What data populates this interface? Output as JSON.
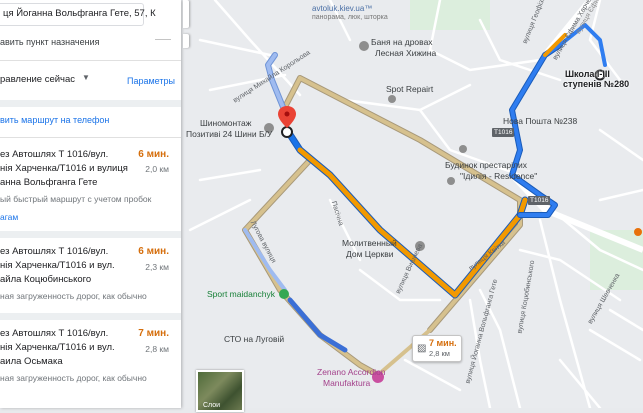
{
  "search": {
    "destination_value": "ця Йоганна Вольфганга Гете, 57, К",
    "add_destination": "авить пункт назначения"
  },
  "options": {
    "depart_now": "равление сейчас",
    "parameters": "Параметры"
  },
  "send_to_phone": "вить маршрут на телефон",
  "routes": [
    {
      "line1": "ез Автошлях Т 1016/вул.",
      "line2": "нія Харченка/Т1016 и вулиця",
      "line3": "анна Вольфганга Гете",
      "time": "6 мин.",
      "distance": "2,0 км",
      "note": "ый быстрый маршрут с учетом пробок",
      "details": "агам"
    },
    {
      "line1": "ез Автошлях Т 1016/вул.",
      "line2": "нія Харченка/Т1016 и вул.",
      "line3": "айла Коцюбинського",
      "time": "6 мин.",
      "distance": "2,3 км",
      "note": "ная загруженность дорог, как обычно"
    },
    {
      "line1": "ез Автошлях Т 1016/вул.",
      "line2": "нія Харченка/Т1016 и вул.",
      "line3": "аила Осьмака",
      "time": "7 мин.",
      "distance": "2,8 км",
      "note": "ная загруженность дорог, как обычно"
    }
  ],
  "map": {
    "watermark": "avtoluk.kiev.ua™",
    "watermark_sub": "панорама, люк, шторка",
    "poi_sauna": [
      "Баня на дровах",
      "Лесная Хижина"
    ],
    "poi_spot_repair": "Spot Repairt",
    "poi_tire": [
      "Шиномонтаж",
      "Позитиві 24 Шини Б/У"
    ],
    "poi_post": "Нова Пошта №238",
    "poi_elderly": [
      "Будинок престарілих",
      "\"Ідилія - Residence\""
    ],
    "poi_church": [
      "Молитвенный",
      "Дом Церкви"
    ],
    "poi_sport": "Sport maidanchyk",
    "poi_sto": "СТО на Луговій",
    "poi_zenano": [
      "Zenano Accordion",
      "Manufaktura"
    ],
    "poi_school": [
      "Школа І-ІІІ",
      "ступенів №280"
    ],
    "street_koroliova": "вулиця Михайла Корольова",
    "street_kharchenka": "вулиця Єфима Харченка",
    "street_kharchenka2": "вулиця Єфима Харченка",
    "street_kvitky": "вулиця Квітки",
    "street_lugova": "Лугова вулиця",
    "street_pasichna": "Пасічна",
    "street_vishneva": "вулиця Вишнева",
    "street_kotsyubynskogo": "вулиця Коцюбинського",
    "street_gete": "вулиця Йоганна Вольфганга Гете",
    "street_shevchenka": "вулиця Шевченка",
    "street_kukhmistra": "вулиця Геофізиків",
    "road_t1016_a": "T1016",
    "road_t1016_b": "T1016",
    "trip_bubble_time": "7 мин.",
    "trip_bubble_dist": "2,8 км",
    "thumb_label": "Слои",
    "colors": {
      "route_fast": "#1a73e8",
      "route_slow": "#f29900",
      "route_alt": "#d6c18e",
      "route_alt_blue": "#7fa8f0"
    }
  }
}
